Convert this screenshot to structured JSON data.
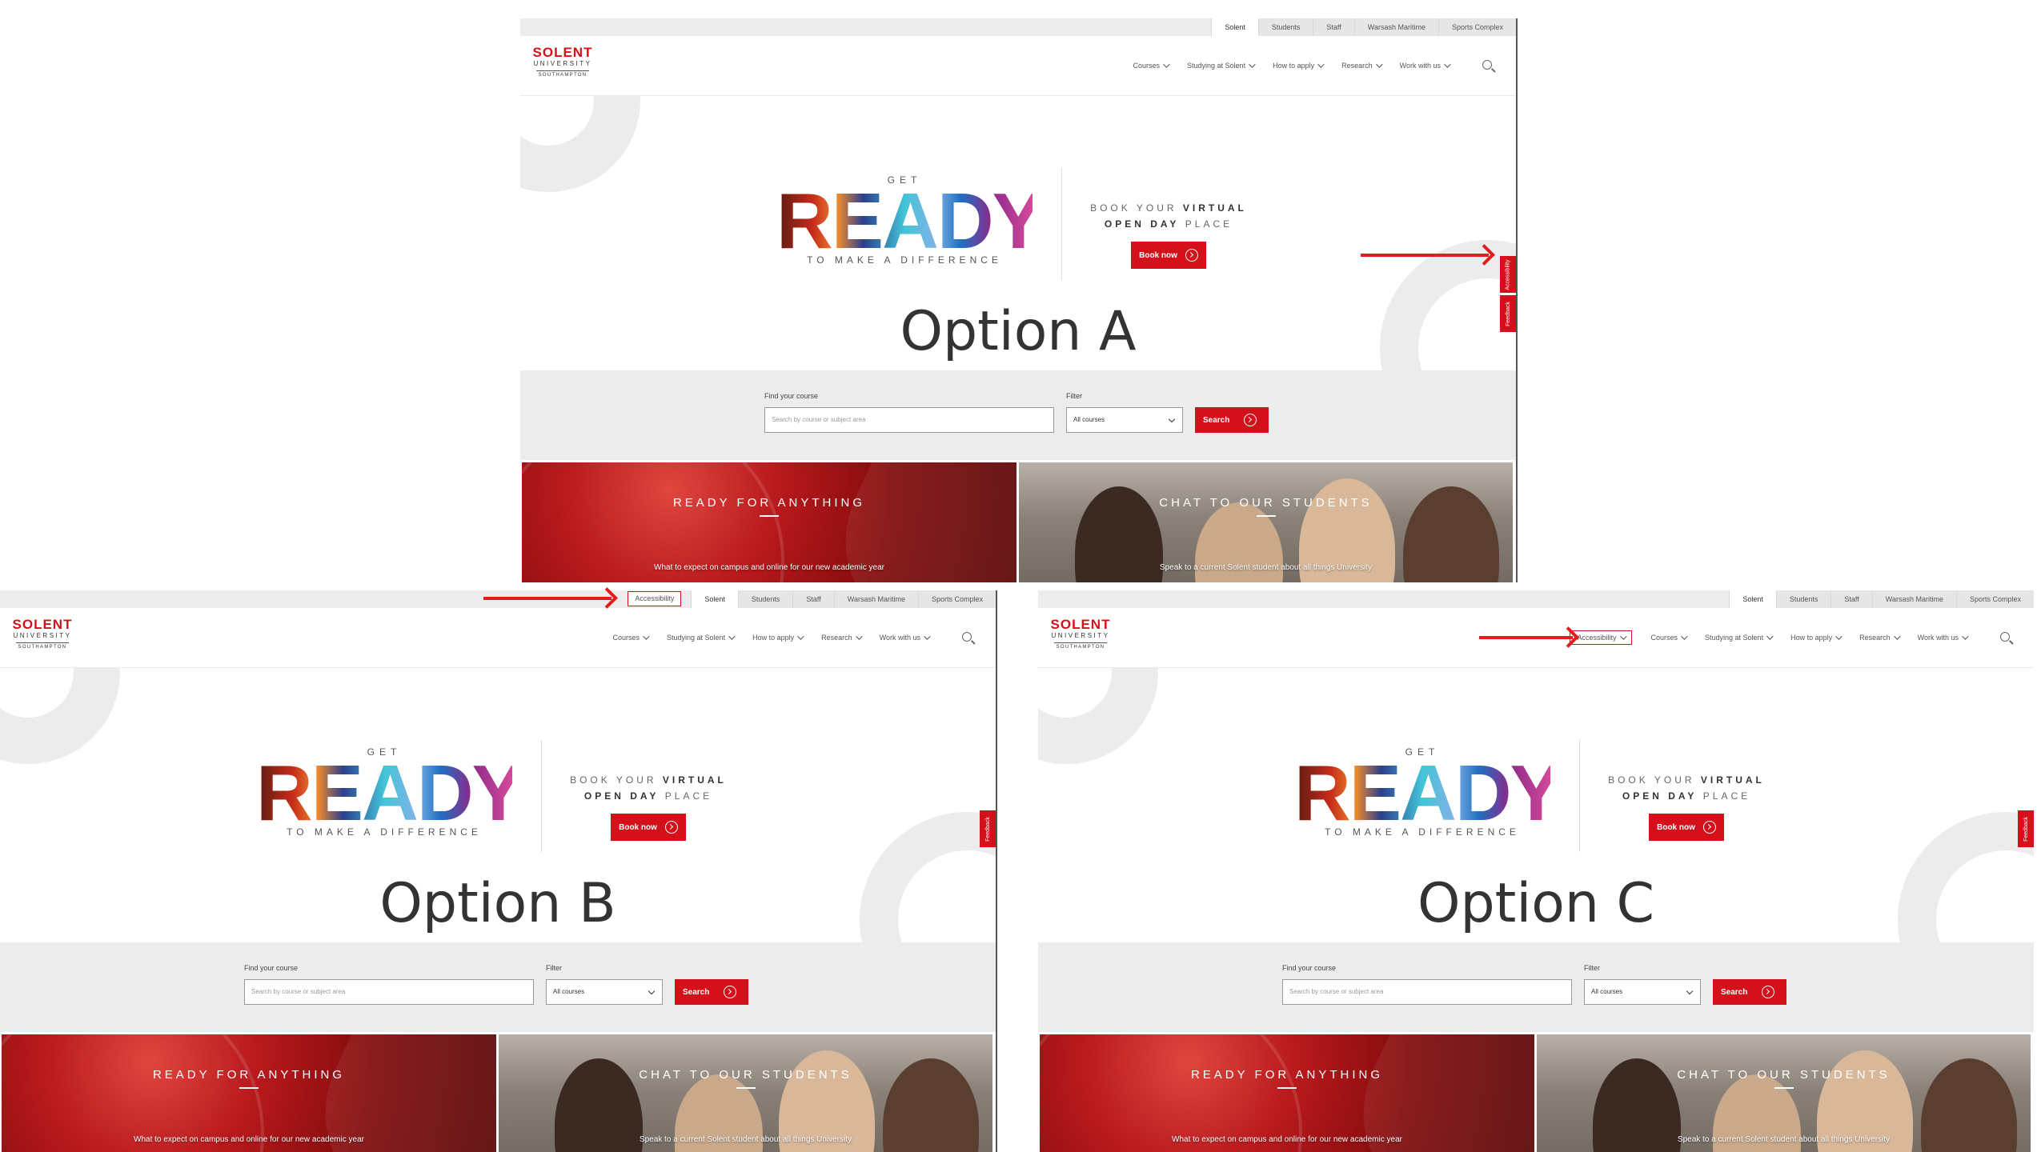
{
  "utility_tabs": [
    "Solent",
    "Students",
    "Staff",
    "Warsash Maritime",
    "Sports Complex"
  ],
  "accessibility_label": "Accessibility",
  "logo": {
    "line1": "SOLENT",
    "line2": "UNIVERSITY",
    "line3": "SOUTHAMPTON"
  },
  "nav": [
    "Courses",
    "Studying at Solent",
    "How to apply",
    "Research",
    "Work with us"
  ],
  "hero": {
    "get": "GET",
    "ready": "READY",
    "tagline": "TO MAKE A DIFFERENCE",
    "openday_line1_pre": "BOOK YOUR ",
    "openday_line1_bold": "VIRTUAL",
    "openday_line2_bold": "OPEN DAY",
    "openday_line2_post": " PLACE",
    "book_now": "Book now"
  },
  "search": {
    "find_label": "Find your course",
    "placeholder": "Search by course or subject area",
    "filter_label": "Filter",
    "filter_value": "All courses",
    "search_button": "Search"
  },
  "promos": [
    {
      "title": "READY FOR ANYTHING",
      "subtitle": "What to expect on campus and online for our new academic year"
    },
    {
      "title": "CHAT TO OUR STUDENTS",
      "subtitle": "Speak to a current Solent student about all things University"
    }
  ],
  "side_tabs": [
    "Accessibility",
    "Feedback"
  ],
  "options": {
    "a": "Option A",
    "b": "Option B",
    "c": "Option C"
  },
  "colors": {
    "brand_red": "#d4101a",
    "annotation_red": "#e51c1c",
    "band_grey": "#ececec"
  }
}
